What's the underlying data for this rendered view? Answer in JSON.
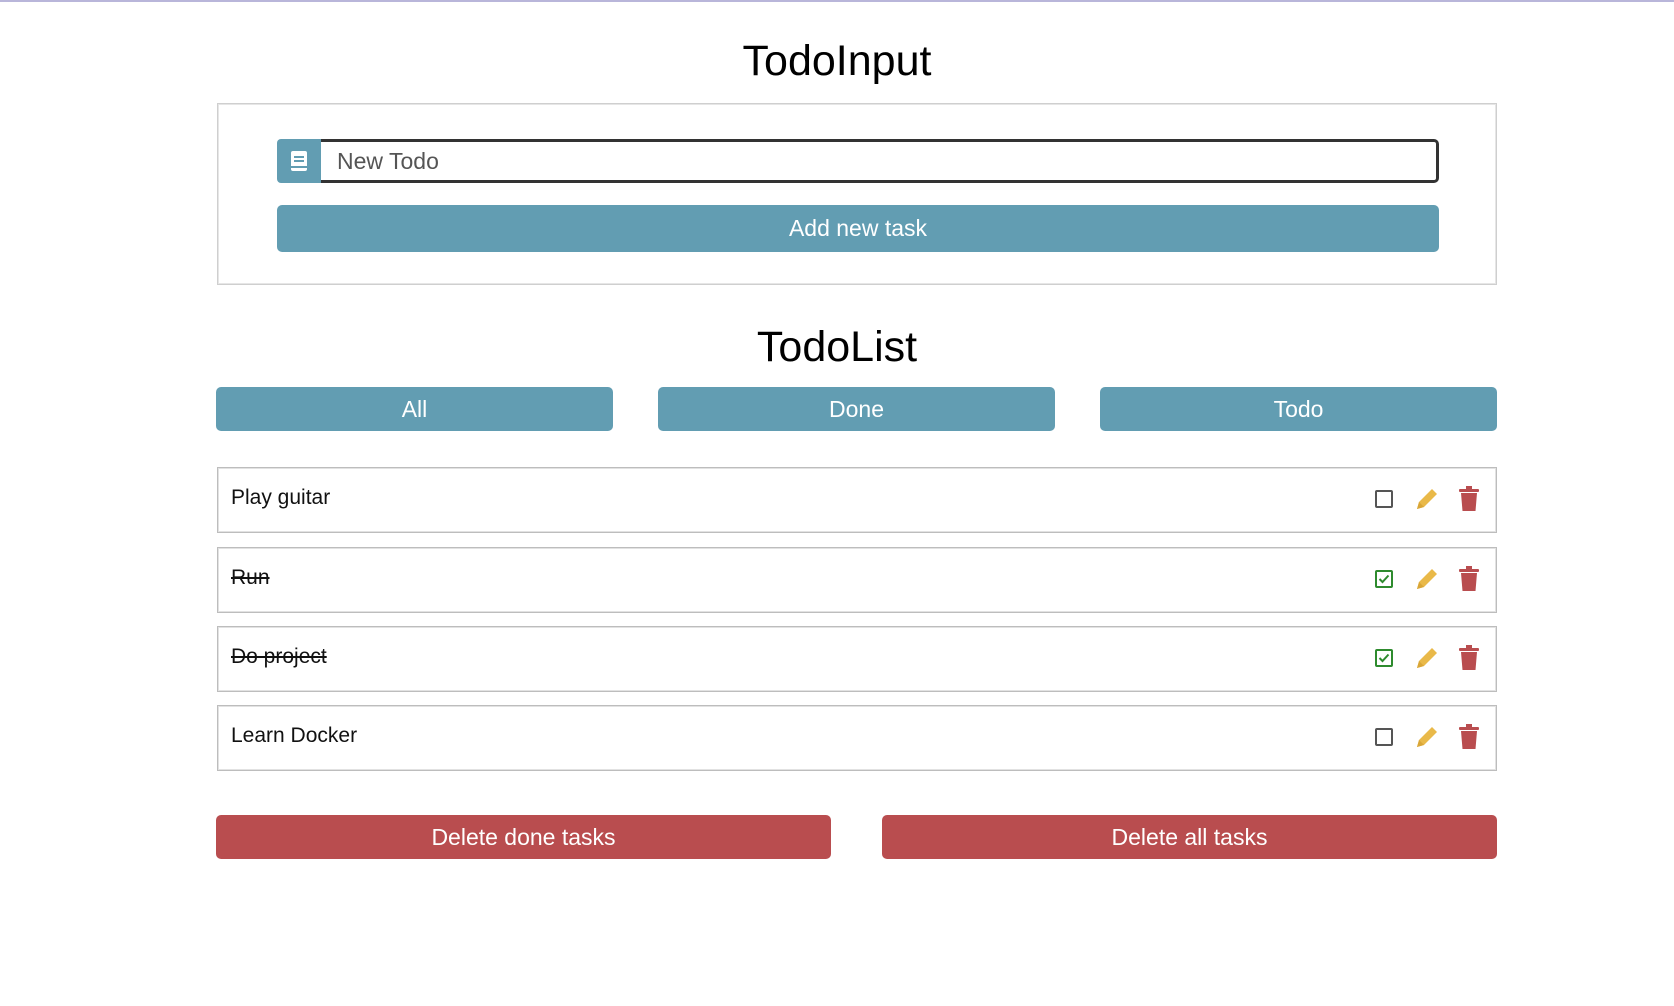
{
  "input_section": {
    "title": "TodoInput",
    "icon": "book-icon",
    "placeholder": "New Todo",
    "add_label": "Add new task"
  },
  "list_section": {
    "title": "TodoList",
    "filters": [
      "All",
      "Done",
      "Todo"
    ]
  },
  "tasks": [
    {
      "text": "Play guitar",
      "done": false
    },
    {
      "text": "Run",
      "done": true
    },
    {
      "text": "Do project",
      "done": true
    },
    {
      "text": "Learn Docker",
      "done": false
    }
  ],
  "actions": {
    "delete_done_label": "Delete done tasks",
    "delete_all_label": "Delete all tasks"
  },
  "colors": {
    "accent": "#629db2",
    "danger": "#b94d4f",
    "edit": "#e9b949",
    "checked": "#2e8b2e"
  }
}
